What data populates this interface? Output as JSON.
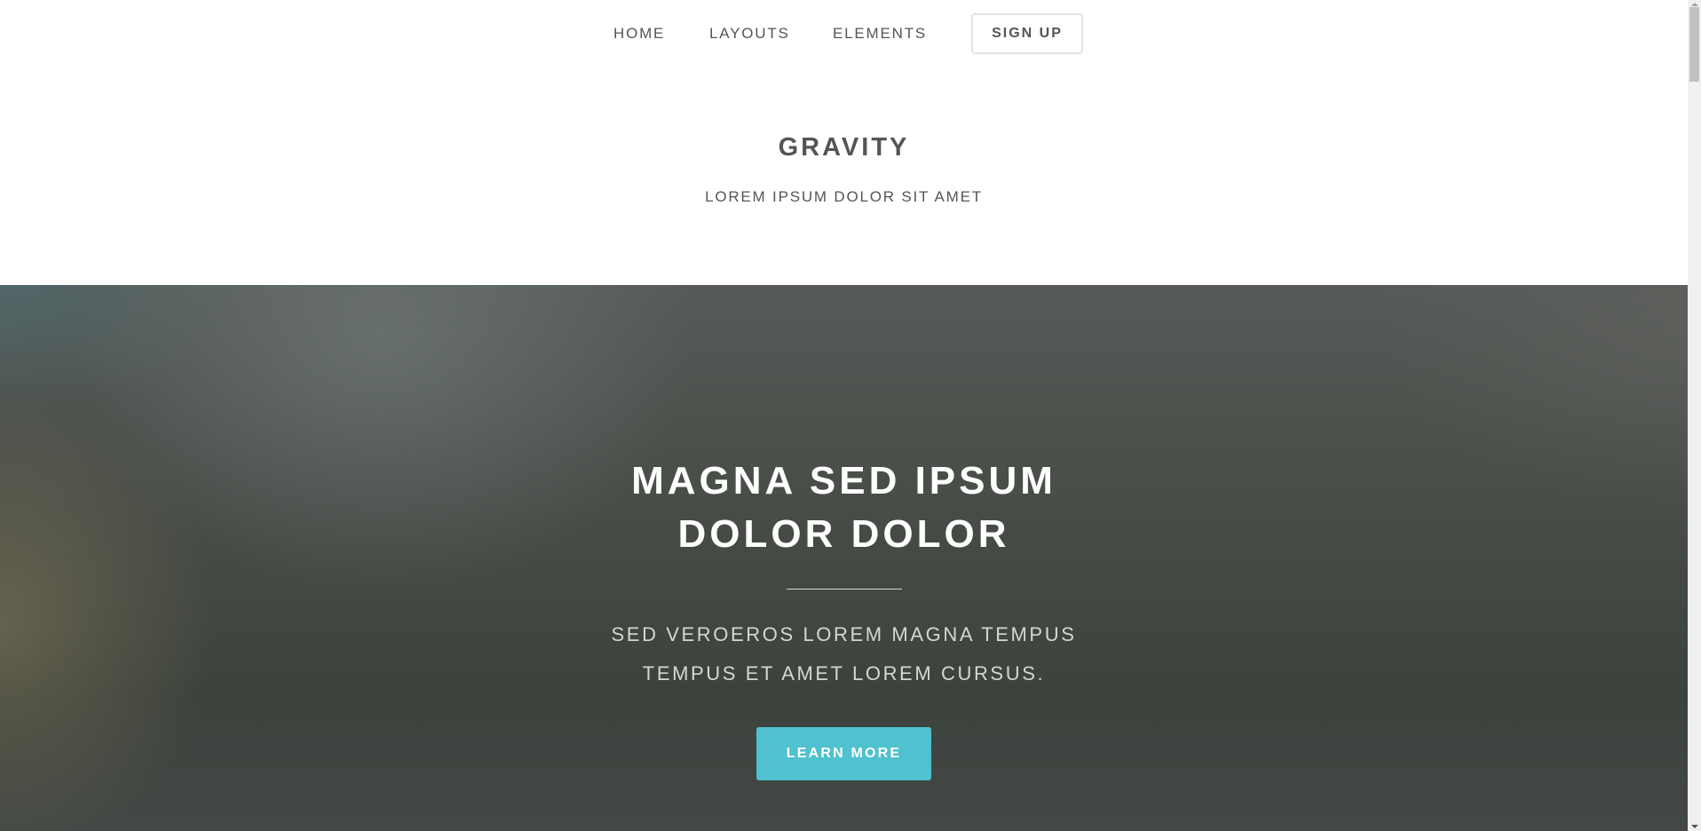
{
  "nav": {
    "items": [
      {
        "label": "HOME"
      },
      {
        "label": "LAYOUTS"
      },
      {
        "label": "ELEMENTS"
      }
    ],
    "signup_label": "SIGN UP"
  },
  "header": {
    "title": "GRAVITY",
    "subtitle": "LOREM IPSUM DOLOR SIT AMET"
  },
  "hero": {
    "heading_line1": "MAGNA SED IPSUM",
    "heading_line2": "DOLOR DOLOR",
    "text_line1": "SED VEROEROS LOREM MAGNA TEMPUS",
    "text_line2": "TEMPUS ET AMET LOREM CURSUS.",
    "button_label": "LEARN MORE"
  },
  "colors": {
    "accent": "#4fc1cf",
    "text": "#555555"
  }
}
